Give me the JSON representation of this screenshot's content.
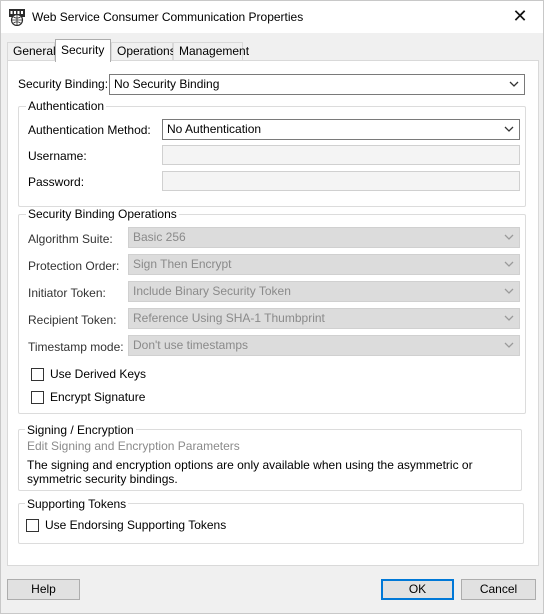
{
  "window": {
    "title": "Web Service Consumer Communication Properties",
    "icon": "soap-icon",
    "close_glyph": "✕"
  },
  "tabs": [
    {
      "label": "General",
      "active": false
    },
    {
      "label": "Security",
      "active": true
    },
    {
      "label": "Operations",
      "active": false
    },
    {
      "label": "Management",
      "active": false
    }
  ],
  "security_binding": {
    "label": "Security Binding:",
    "value": "No Security Binding"
  },
  "authentication": {
    "title": "Authentication",
    "method_label": "Authentication Method:",
    "method_value": "No Authentication",
    "username_label": "Username:",
    "username_value": "",
    "password_label": "Password:",
    "password_value": ""
  },
  "operations": {
    "title": "Security Binding Operations",
    "algorithm_label": "Algorithm Suite:",
    "algorithm_value": "Basic 256",
    "protection_label": "Protection Order:",
    "protection_value": "Sign Then Encrypt",
    "initiator_label": "Initiator Token:",
    "initiator_value": "Include Binary Security Token",
    "recipient_label": "Recipient Token:",
    "recipient_value": "Reference Using SHA-1 Thumbprint",
    "timestamp_label": "Timestamp mode:",
    "timestamp_value": "Don't use timestamps",
    "use_derived_keys": {
      "label": "Use Derived Keys",
      "checked": false
    },
    "encrypt_signature": {
      "label": "Encrypt Signature",
      "checked": false
    }
  },
  "signing": {
    "title": "Signing / Encryption",
    "link": "Edit Signing and Encryption Parameters",
    "note": "The signing and encryption options are only available when using the asymmetric or symmetric security bindings."
  },
  "supporting": {
    "title": "Supporting Tokens",
    "endorsing": {
      "label": "Use Endorsing Supporting Tokens",
      "checked": false
    }
  },
  "buttons": {
    "help": "Help",
    "ok": "OK",
    "cancel": "Cancel"
  },
  "colors": {
    "accent": "#0078d7",
    "disabled_field": "#dcdcdc",
    "window_bg": "#f0f0f0"
  }
}
